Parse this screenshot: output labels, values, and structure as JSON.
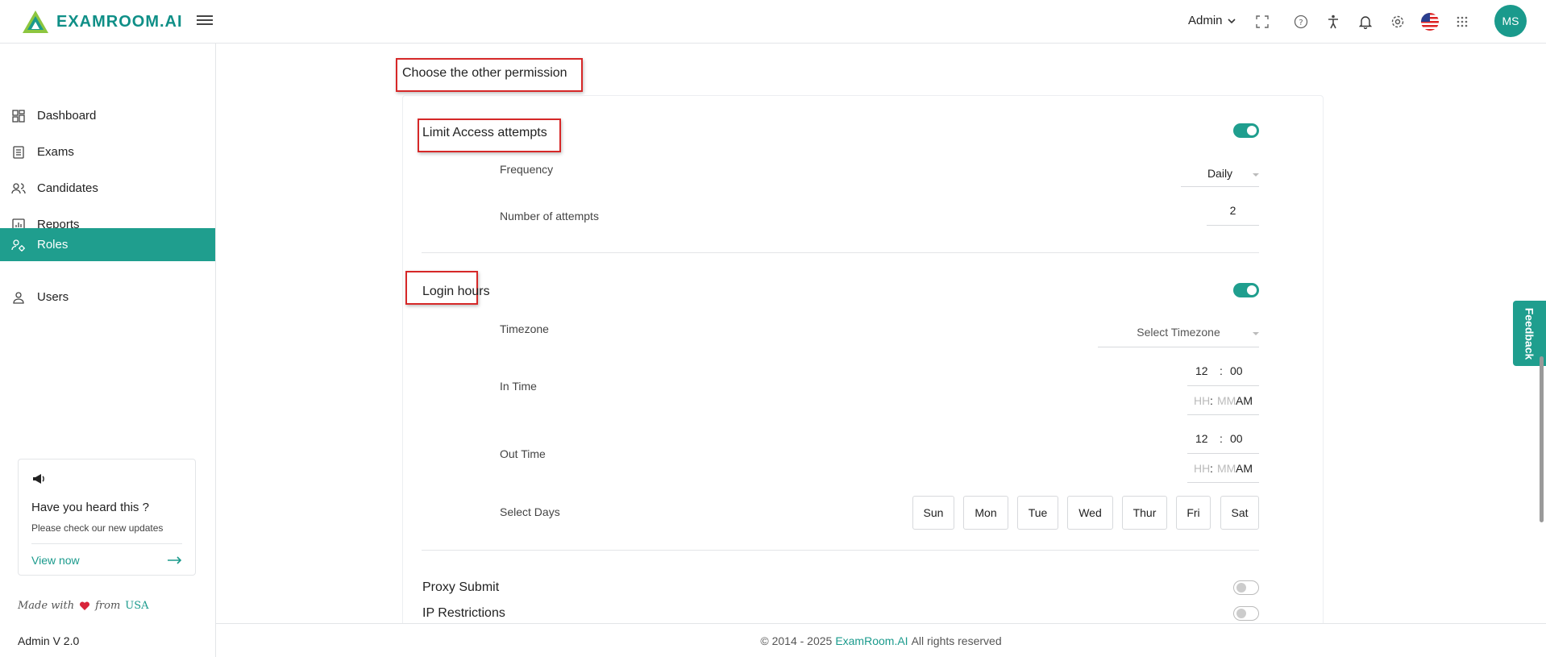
{
  "header": {
    "logo_text": "EXAMROOM.AI",
    "role_menu": "Admin",
    "avatar_initials": "MS",
    "icons": [
      "menu-icon",
      "fullscreen-icon",
      "help-icon",
      "accessibility-icon",
      "bell-icon",
      "settings-icon",
      "us-flag-icon",
      "apps-grid-icon"
    ]
  },
  "sidebar": {
    "items": [
      {
        "label": "Dashboard",
        "icon": "dashboard-icon"
      },
      {
        "label": "Exams",
        "icon": "exams-icon"
      },
      {
        "label": "Candidates",
        "icon": "candidates-icon"
      },
      {
        "label": "Reports",
        "icon": "reports-icon"
      },
      {
        "label": "Roles",
        "icon": "roles-icon",
        "active": true
      },
      {
        "label": "Users",
        "icon": "users-icon"
      }
    ],
    "promo": {
      "title": "Have you heard this ?",
      "subtitle": "Please check our new updates",
      "link": "View now"
    },
    "made_with_prefix": "Made with",
    "made_with_suffix": "from",
    "made_with_country": "USA",
    "version": "Admin V 2.0"
  },
  "main": {
    "page_heading": "Choose the other permission",
    "limit_access": {
      "title": "Limit Access attempts",
      "enabled": true,
      "frequency_label": "Frequency",
      "frequency_value": "Daily",
      "attempts_label": "Number of attempts",
      "attempts_value": "2"
    },
    "login_hours": {
      "title": "Login hours",
      "enabled": true,
      "timezone_label": "Timezone",
      "timezone_placeholder": "Select Timezone",
      "in_time_label": "In Time",
      "in_hour": "12",
      "in_min": "00",
      "out_time_label": "Out Time",
      "out_hour": "12",
      "out_min": "00",
      "time_sep": ":",
      "hh_placeholder": "HH",
      "mm_placeholder": "MM",
      "meridiem": "AM",
      "days_label": "Select Days",
      "days": [
        "Sun",
        "Mon",
        "Tue",
        "Wed",
        "Thur",
        "Fri",
        "Sat"
      ]
    },
    "proxy_submit": {
      "title": "Proxy Submit",
      "enabled": false
    },
    "ip_restrictions": {
      "title": "IP Restrictions",
      "enabled": false
    }
  },
  "footer": {
    "prefix": "© 2014 - 2025",
    "brand": "ExamRoom.AI",
    "suffix": "All rights reserved"
  },
  "feedback_label": "Feedback",
  "colors": {
    "accent": "#1f9e8e",
    "highlight": "#d62828"
  }
}
